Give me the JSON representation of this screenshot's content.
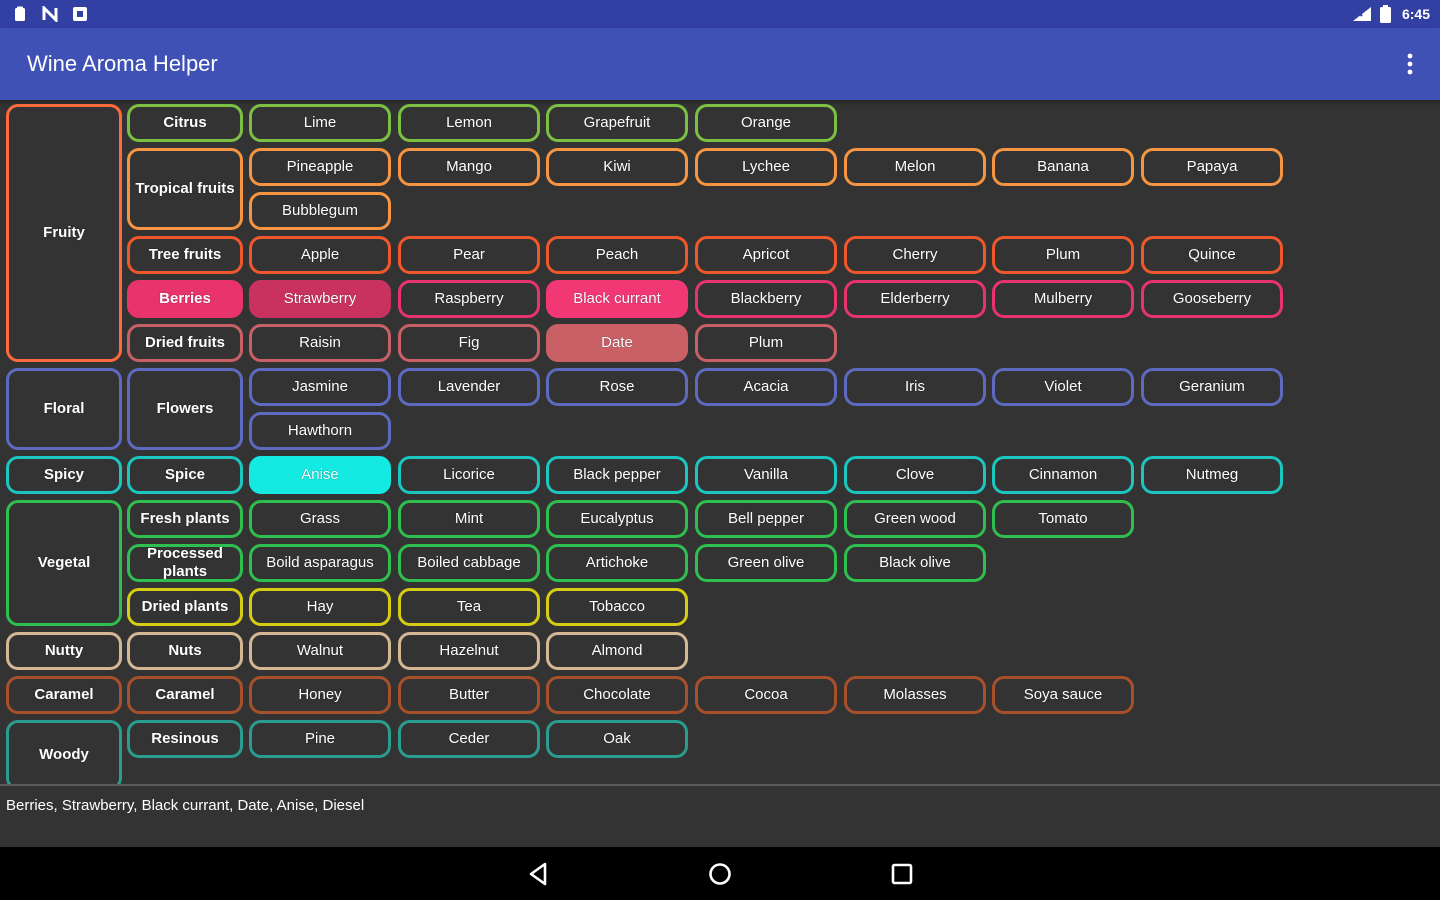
{
  "status_bar": {
    "time": "6:45",
    "left_icons": [
      "clipboard-icon",
      "nfc-n-icon",
      "square-notification-icon"
    ],
    "right_icons": [
      "signal-icon",
      "battery-icon"
    ]
  },
  "app_bar": {
    "title": "Wine Aroma Helper",
    "menu_icon": "overflow-menu-icon"
  },
  "colors": {
    "status_bar": "#3240a3",
    "app_bar": "#3f51b5",
    "background": "#333333",
    "fruity": "#ff6a3d",
    "citrus": "#7bc043",
    "tropical": "#f59542",
    "tree_fruits": "#f0582c",
    "berries": "#e8336d",
    "dried_fruits": "#c96066",
    "floral": "#5c6bc0",
    "spicy": "#1bc6c0",
    "vegetal": "#2fbf4e",
    "dried_plants": "#d6cd12",
    "nutty": "#d4b894",
    "caramel": "#a8502a",
    "woody": "#2a9d8f"
  },
  "aroma_rows": [
    {
      "category": "Fruity",
      "sub": "Citrus",
      "items": [
        "Lime",
        "Lemon",
        "Grapefruit",
        "Orange"
      ]
    },
    {
      "category": "Fruity",
      "sub": "Tropical fruits",
      "items": [
        "Pineapple",
        "Mango",
        "Kiwi",
        "Lychee",
        "Melon",
        "Banana",
        "Papaya",
        "Bubblegum"
      ]
    },
    {
      "category": "Fruity",
      "sub": "Tree fruits",
      "items": [
        "Apple",
        "Pear",
        "Peach",
        "Apricot",
        "Cherry",
        "Plum",
        "Quince"
      ]
    },
    {
      "category": "Fruity",
      "sub": "Berries",
      "items": [
        "Strawberry",
        "Raspberry",
        "Black currant",
        "Blackberry",
        "Elderberry",
        "Mulberry",
        "Gooseberry"
      ]
    },
    {
      "category": "Fruity",
      "sub": "Dried fruits",
      "items": [
        "Raisin",
        "Fig",
        "Date",
        "Plum"
      ]
    },
    {
      "category": "Floral",
      "sub": "Flowers",
      "items": [
        "Jasmine",
        "Lavender",
        "Rose",
        "Acacia",
        "Iris",
        "Violet",
        "Geranium",
        "Hawthorn"
      ]
    },
    {
      "category": "Spicy",
      "sub": "Spice",
      "items": [
        "Anise",
        "Licorice",
        "Black pepper",
        "Vanilla",
        "Clove",
        "Cinnamon",
        "Nutmeg"
      ]
    },
    {
      "category": "Vegetal",
      "sub": "Fresh plants",
      "items": [
        "Grass",
        "Mint",
        "Eucalyptus",
        "Bell pepper",
        "Green wood",
        "Tomato"
      ]
    },
    {
      "category": "Vegetal",
      "sub": "Processed plants",
      "items": [
        "Boild asparagus",
        "Boiled cabbage",
        "Artichoke",
        "Green olive",
        "Black olive"
      ]
    },
    {
      "category": "Vegetal",
      "sub": "Dried plants",
      "items": [
        "Hay",
        "Tea",
        "Tobacco"
      ]
    },
    {
      "category": "Nutty",
      "sub": "Nuts",
      "items": [
        "Walnut",
        "Hazelnut",
        "Almond"
      ]
    },
    {
      "category": "Caramel",
      "sub": "Caramel",
      "items": [
        "Honey",
        "Butter",
        "Chocolate",
        "Cocoa",
        "Molasses",
        "Soya sauce"
      ]
    },
    {
      "category": "Woody",
      "sub": "Resinous",
      "items": [
        "Pine",
        "Ceder",
        "Oak"
      ]
    }
  ],
  "selected": [
    "Berries",
    "Strawberry",
    "Black currant",
    "Date",
    "Anise"
  ],
  "selection_text": "Berries, Strawberry, Black currant, Date, Anise, Diesel",
  "nav_bar": {
    "back_icon": "back-triangle-icon",
    "home_icon": "home-circle-icon",
    "recents_icon": "recents-square-icon"
  }
}
